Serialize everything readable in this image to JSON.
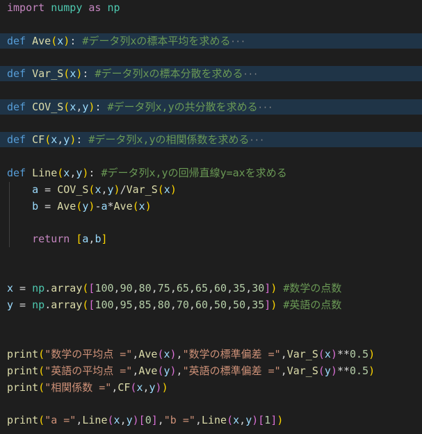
{
  "editor": {
    "lines": [
      {
        "id": "import",
        "tokens": [
          {
            "t": "import",
            "c": "kw2"
          },
          {
            "t": " ",
            "c": "plain"
          },
          {
            "t": "numpy",
            "c": "mod"
          },
          {
            "t": " ",
            "c": "plain"
          },
          {
            "t": "as",
            "c": "kw2"
          },
          {
            "t": " ",
            "c": "plain"
          },
          {
            "t": "np",
            "c": "mod"
          }
        ]
      },
      {
        "id": "def-ave",
        "folded": true,
        "tokens": [
          {
            "t": "def",
            "c": "kw"
          },
          {
            "t": " ",
            "c": "plain"
          },
          {
            "t": "Ave",
            "c": "fn"
          },
          {
            "t": "(",
            "c": "p1"
          },
          {
            "t": "x",
            "c": "var"
          },
          {
            "t": ")",
            "c": "p1"
          },
          {
            "t": ": ",
            "c": "plain"
          },
          {
            "t": "#データ列xの標本平均を求める",
            "c": "cmt"
          },
          {
            "t": "···",
            "c": "ellipsis"
          }
        ]
      },
      {
        "id": "def-var",
        "folded": true,
        "tokens": [
          {
            "t": "def",
            "c": "kw"
          },
          {
            "t": " ",
            "c": "plain"
          },
          {
            "t": "Var_S",
            "c": "fn"
          },
          {
            "t": "(",
            "c": "p1"
          },
          {
            "t": "x",
            "c": "var"
          },
          {
            "t": ")",
            "c": "p1"
          },
          {
            "t": ": ",
            "c": "plain"
          },
          {
            "t": "#データ列xの標本分散を求める",
            "c": "cmt"
          },
          {
            "t": "···",
            "c": "ellipsis"
          }
        ]
      },
      {
        "id": "def-cov",
        "folded": true,
        "tokens": [
          {
            "t": "def",
            "c": "kw"
          },
          {
            "t": " ",
            "c": "plain"
          },
          {
            "t": "COV_S",
            "c": "fn"
          },
          {
            "t": "(",
            "c": "p1"
          },
          {
            "t": "x",
            "c": "var"
          },
          {
            "t": ",",
            "c": "plain"
          },
          {
            "t": "y",
            "c": "var"
          },
          {
            "t": ")",
            "c": "p1"
          },
          {
            "t": ": ",
            "c": "plain"
          },
          {
            "t": "#データ列x,yの共分散を求める",
            "c": "cmt"
          },
          {
            "t": "···",
            "c": "ellipsis"
          }
        ]
      },
      {
        "id": "def-cf",
        "folded": true,
        "tokens": [
          {
            "t": "def",
            "c": "kw"
          },
          {
            "t": " ",
            "c": "plain"
          },
          {
            "t": "CF",
            "c": "fn"
          },
          {
            "t": "(",
            "c": "p1"
          },
          {
            "t": "x",
            "c": "var"
          },
          {
            "t": ",",
            "c": "plain"
          },
          {
            "t": "y",
            "c": "var"
          },
          {
            "t": ")",
            "c": "p1"
          },
          {
            "t": ": ",
            "c": "plain"
          },
          {
            "t": "#データ列x,yの相関係数を求める",
            "c": "cmt"
          },
          {
            "t": "···",
            "c": "ellipsis"
          }
        ]
      },
      {
        "id": "def-line",
        "tokens": [
          {
            "t": "def",
            "c": "kw"
          },
          {
            "t": " ",
            "c": "plain"
          },
          {
            "t": "Line",
            "c": "fn"
          },
          {
            "t": "(",
            "c": "p1"
          },
          {
            "t": "x",
            "c": "var"
          },
          {
            "t": ",",
            "c": "plain"
          },
          {
            "t": "y",
            "c": "var"
          },
          {
            "t": ")",
            "c": "p1"
          },
          {
            "t": ": ",
            "c": "plain"
          },
          {
            "t": "#データ列x,yの回帰直線y=axを求める",
            "c": "cmt"
          }
        ]
      },
      {
        "id": "assign-a",
        "tokens": [
          {
            "t": "    ",
            "c": "plain"
          },
          {
            "t": "a",
            "c": "var"
          },
          {
            "t": " = ",
            "c": "plain"
          },
          {
            "t": "COV_S",
            "c": "fn"
          },
          {
            "t": "(",
            "c": "p1"
          },
          {
            "t": "x",
            "c": "var"
          },
          {
            "t": ",",
            "c": "plain"
          },
          {
            "t": "y",
            "c": "var"
          },
          {
            "t": ")",
            "c": "p1"
          },
          {
            "t": "/",
            "c": "plain"
          },
          {
            "t": "Var_S",
            "c": "fn"
          },
          {
            "t": "(",
            "c": "p1"
          },
          {
            "t": "x",
            "c": "var"
          },
          {
            "t": ")",
            "c": "p1"
          }
        ]
      },
      {
        "id": "assign-b",
        "tokens": [
          {
            "t": "    ",
            "c": "plain"
          },
          {
            "t": "b",
            "c": "var"
          },
          {
            "t": " = ",
            "c": "plain"
          },
          {
            "t": "Ave",
            "c": "fn"
          },
          {
            "t": "(",
            "c": "p1"
          },
          {
            "t": "y",
            "c": "var"
          },
          {
            "t": ")",
            "c": "p1"
          },
          {
            "t": "-",
            "c": "plain"
          },
          {
            "t": "a",
            "c": "var"
          },
          {
            "t": "*",
            "c": "plain"
          },
          {
            "t": "Ave",
            "c": "fn"
          },
          {
            "t": "(",
            "c": "p1"
          },
          {
            "t": "x",
            "c": "var"
          },
          {
            "t": ")",
            "c": "p1"
          }
        ]
      },
      {
        "id": "return",
        "tokens": [
          {
            "t": "    ",
            "c": "plain"
          },
          {
            "t": "return",
            "c": "kw2"
          },
          {
            "t": " ",
            "c": "plain"
          },
          {
            "t": "[",
            "c": "p1"
          },
          {
            "t": "a",
            "c": "var"
          },
          {
            "t": ",",
            "c": "plain"
          },
          {
            "t": "b",
            "c": "var"
          },
          {
            "t": "]",
            "c": "p1"
          }
        ]
      },
      {
        "id": "assign-x",
        "tokens": [
          {
            "t": "x",
            "c": "var"
          },
          {
            "t": " = ",
            "c": "plain"
          },
          {
            "t": "np",
            "c": "mod"
          },
          {
            "t": ".",
            "c": "plain"
          },
          {
            "t": "array",
            "c": "fn"
          },
          {
            "t": "(",
            "c": "p1"
          },
          {
            "t": "[",
            "c": "p2"
          },
          {
            "t": "100",
            "c": "num"
          },
          {
            "t": ",",
            "c": "plain"
          },
          {
            "t": "90",
            "c": "num"
          },
          {
            "t": ",",
            "c": "plain"
          },
          {
            "t": "80",
            "c": "num"
          },
          {
            "t": ",",
            "c": "plain"
          },
          {
            "t": "75",
            "c": "num"
          },
          {
            "t": ",",
            "c": "plain"
          },
          {
            "t": "65",
            "c": "num"
          },
          {
            "t": ",",
            "c": "plain"
          },
          {
            "t": "65",
            "c": "num"
          },
          {
            "t": ",",
            "c": "plain"
          },
          {
            "t": "60",
            "c": "num"
          },
          {
            "t": ",",
            "c": "plain"
          },
          {
            "t": "35",
            "c": "num"
          },
          {
            "t": ",",
            "c": "plain"
          },
          {
            "t": "30",
            "c": "num"
          },
          {
            "t": "]",
            "c": "p2"
          },
          {
            "t": ")",
            "c": "p1"
          },
          {
            "t": " ",
            "c": "plain"
          },
          {
            "t": "#数学の点数",
            "c": "cmt"
          }
        ]
      },
      {
        "id": "assign-y",
        "tokens": [
          {
            "t": "y",
            "c": "var"
          },
          {
            "t": " = ",
            "c": "plain"
          },
          {
            "t": "np",
            "c": "mod"
          },
          {
            "t": ".",
            "c": "plain"
          },
          {
            "t": "array",
            "c": "fn"
          },
          {
            "t": "(",
            "c": "p1"
          },
          {
            "t": "[",
            "c": "p2"
          },
          {
            "t": "100",
            "c": "num"
          },
          {
            "t": ",",
            "c": "plain"
          },
          {
            "t": "95",
            "c": "num"
          },
          {
            "t": ",",
            "c": "plain"
          },
          {
            "t": "85",
            "c": "num"
          },
          {
            "t": ",",
            "c": "plain"
          },
          {
            "t": "80",
            "c": "num"
          },
          {
            "t": ",",
            "c": "plain"
          },
          {
            "t": "70",
            "c": "num"
          },
          {
            "t": ",",
            "c": "plain"
          },
          {
            "t": "60",
            "c": "num"
          },
          {
            "t": ",",
            "c": "plain"
          },
          {
            "t": "50",
            "c": "num"
          },
          {
            "t": ",",
            "c": "plain"
          },
          {
            "t": "50",
            "c": "num"
          },
          {
            "t": ",",
            "c": "plain"
          },
          {
            "t": "35",
            "c": "num"
          },
          {
            "t": "]",
            "c": "p2"
          },
          {
            "t": ")",
            "c": "p1"
          },
          {
            "t": " ",
            "c": "plain"
          },
          {
            "t": "#英語の点数",
            "c": "cmt"
          }
        ]
      },
      {
        "id": "print-1",
        "tokens": [
          {
            "t": "print",
            "c": "fn"
          },
          {
            "t": "(",
            "c": "p1"
          },
          {
            "t": "\"数学の平均点 =\"",
            "c": "str"
          },
          {
            "t": ",",
            "c": "plain"
          },
          {
            "t": "Ave",
            "c": "fn"
          },
          {
            "t": "(",
            "c": "p2"
          },
          {
            "t": "x",
            "c": "var"
          },
          {
            "t": ")",
            "c": "p2"
          },
          {
            "t": ",",
            "c": "plain"
          },
          {
            "t": "\"数学の標準偏差 =\"",
            "c": "str"
          },
          {
            "t": ",",
            "c": "plain"
          },
          {
            "t": "Var_S",
            "c": "fn"
          },
          {
            "t": "(",
            "c": "p2"
          },
          {
            "t": "x",
            "c": "var"
          },
          {
            "t": ")",
            "c": "p2"
          },
          {
            "t": "**",
            "c": "plain"
          },
          {
            "t": "0.5",
            "c": "num"
          },
          {
            "t": ")",
            "c": "p1"
          }
        ]
      },
      {
        "id": "print-2",
        "tokens": [
          {
            "t": "print",
            "c": "fn"
          },
          {
            "t": "(",
            "c": "p1"
          },
          {
            "t": "\"英語の平均点 =\"",
            "c": "str"
          },
          {
            "t": ",",
            "c": "plain"
          },
          {
            "t": "Ave",
            "c": "fn"
          },
          {
            "t": "(",
            "c": "p2"
          },
          {
            "t": "y",
            "c": "var"
          },
          {
            "t": ")",
            "c": "p2"
          },
          {
            "t": ",",
            "c": "plain"
          },
          {
            "t": "\"英語の標準偏差 =\"",
            "c": "str"
          },
          {
            "t": ",",
            "c": "plain"
          },
          {
            "t": "Var_S",
            "c": "fn"
          },
          {
            "t": "(",
            "c": "p2"
          },
          {
            "t": "y",
            "c": "var"
          },
          {
            "t": ")",
            "c": "p2"
          },
          {
            "t": "**",
            "c": "plain"
          },
          {
            "t": "0.5",
            "c": "num"
          },
          {
            "t": ")",
            "c": "p1"
          }
        ]
      },
      {
        "id": "print-3",
        "tokens": [
          {
            "t": "print",
            "c": "fn"
          },
          {
            "t": "(",
            "c": "p1"
          },
          {
            "t": "\"相関係数 =\"",
            "c": "str"
          },
          {
            "t": ",",
            "c": "plain"
          },
          {
            "t": "CF",
            "c": "fn"
          },
          {
            "t": "(",
            "c": "p2"
          },
          {
            "t": "x",
            "c": "var"
          },
          {
            "t": ",",
            "c": "plain"
          },
          {
            "t": "y",
            "c": "var"
          },
          {
            "t": ")",
            "c": "p2"
          },
          {
            "t": ")",
            "c": "p1"
          }
        ]
      },
      {
        "id": "print-4",
        "tokens": [
          {
            "t": "print",
            "c": "fn"
          },
          {
            "t": "(",
            "c": "p1"
          },
          {
            "t": "\"a =\"",
            "c": "str"
          },
          {
            "t": ",",
            "c": "plain"
          },
          {
            "t": "Line",
            "c": "fn"
          },
          {
            "t": "(",
            "c": "p2"
          },
          {
            "t": "x",
            "c": "var"
          },
          {
            "t": ",",
            "c": "plain"
          },
          {
            "t": "y",
            "c": "var"
          },
          {
            "t": ")",
            "c": "p2"
          },
          {
            "t": "[",
            "c": "p2"
          },
          {
            "t": "0",
            "c": "num"
          },
          {
            "t": "]",
            "c": "p2"
          },
          {
            "t": ",",
            "c": "plain"
          },
          {
            "t": "\"b =\"",
            "c": "str"
          },
          {
            "t": ",",
            "c": "plain"
          },
          {
            "t": "Line",
            "c": "fn"
          },
          {
            "t": "(",
            "c": "p2"
          },
          {
            "t": "x",
            "c": "var"
          },
          {
            "t": ",",
            "c": "plain"
          },
          {
            "t": "y",
            "c": "var"
          },
          {
            "t": ")",
            "c": "p2"
          },
          {
            "t": "[",
            "c": "p2"
          },
          {
            "t": "1",
            "c": "num"
          },
          {
            "t": "]",
            "c": "p2"
          },
          {
            "t": ")",
            "c": "p1"
          }
        ]
      }
    ]
  }
}
